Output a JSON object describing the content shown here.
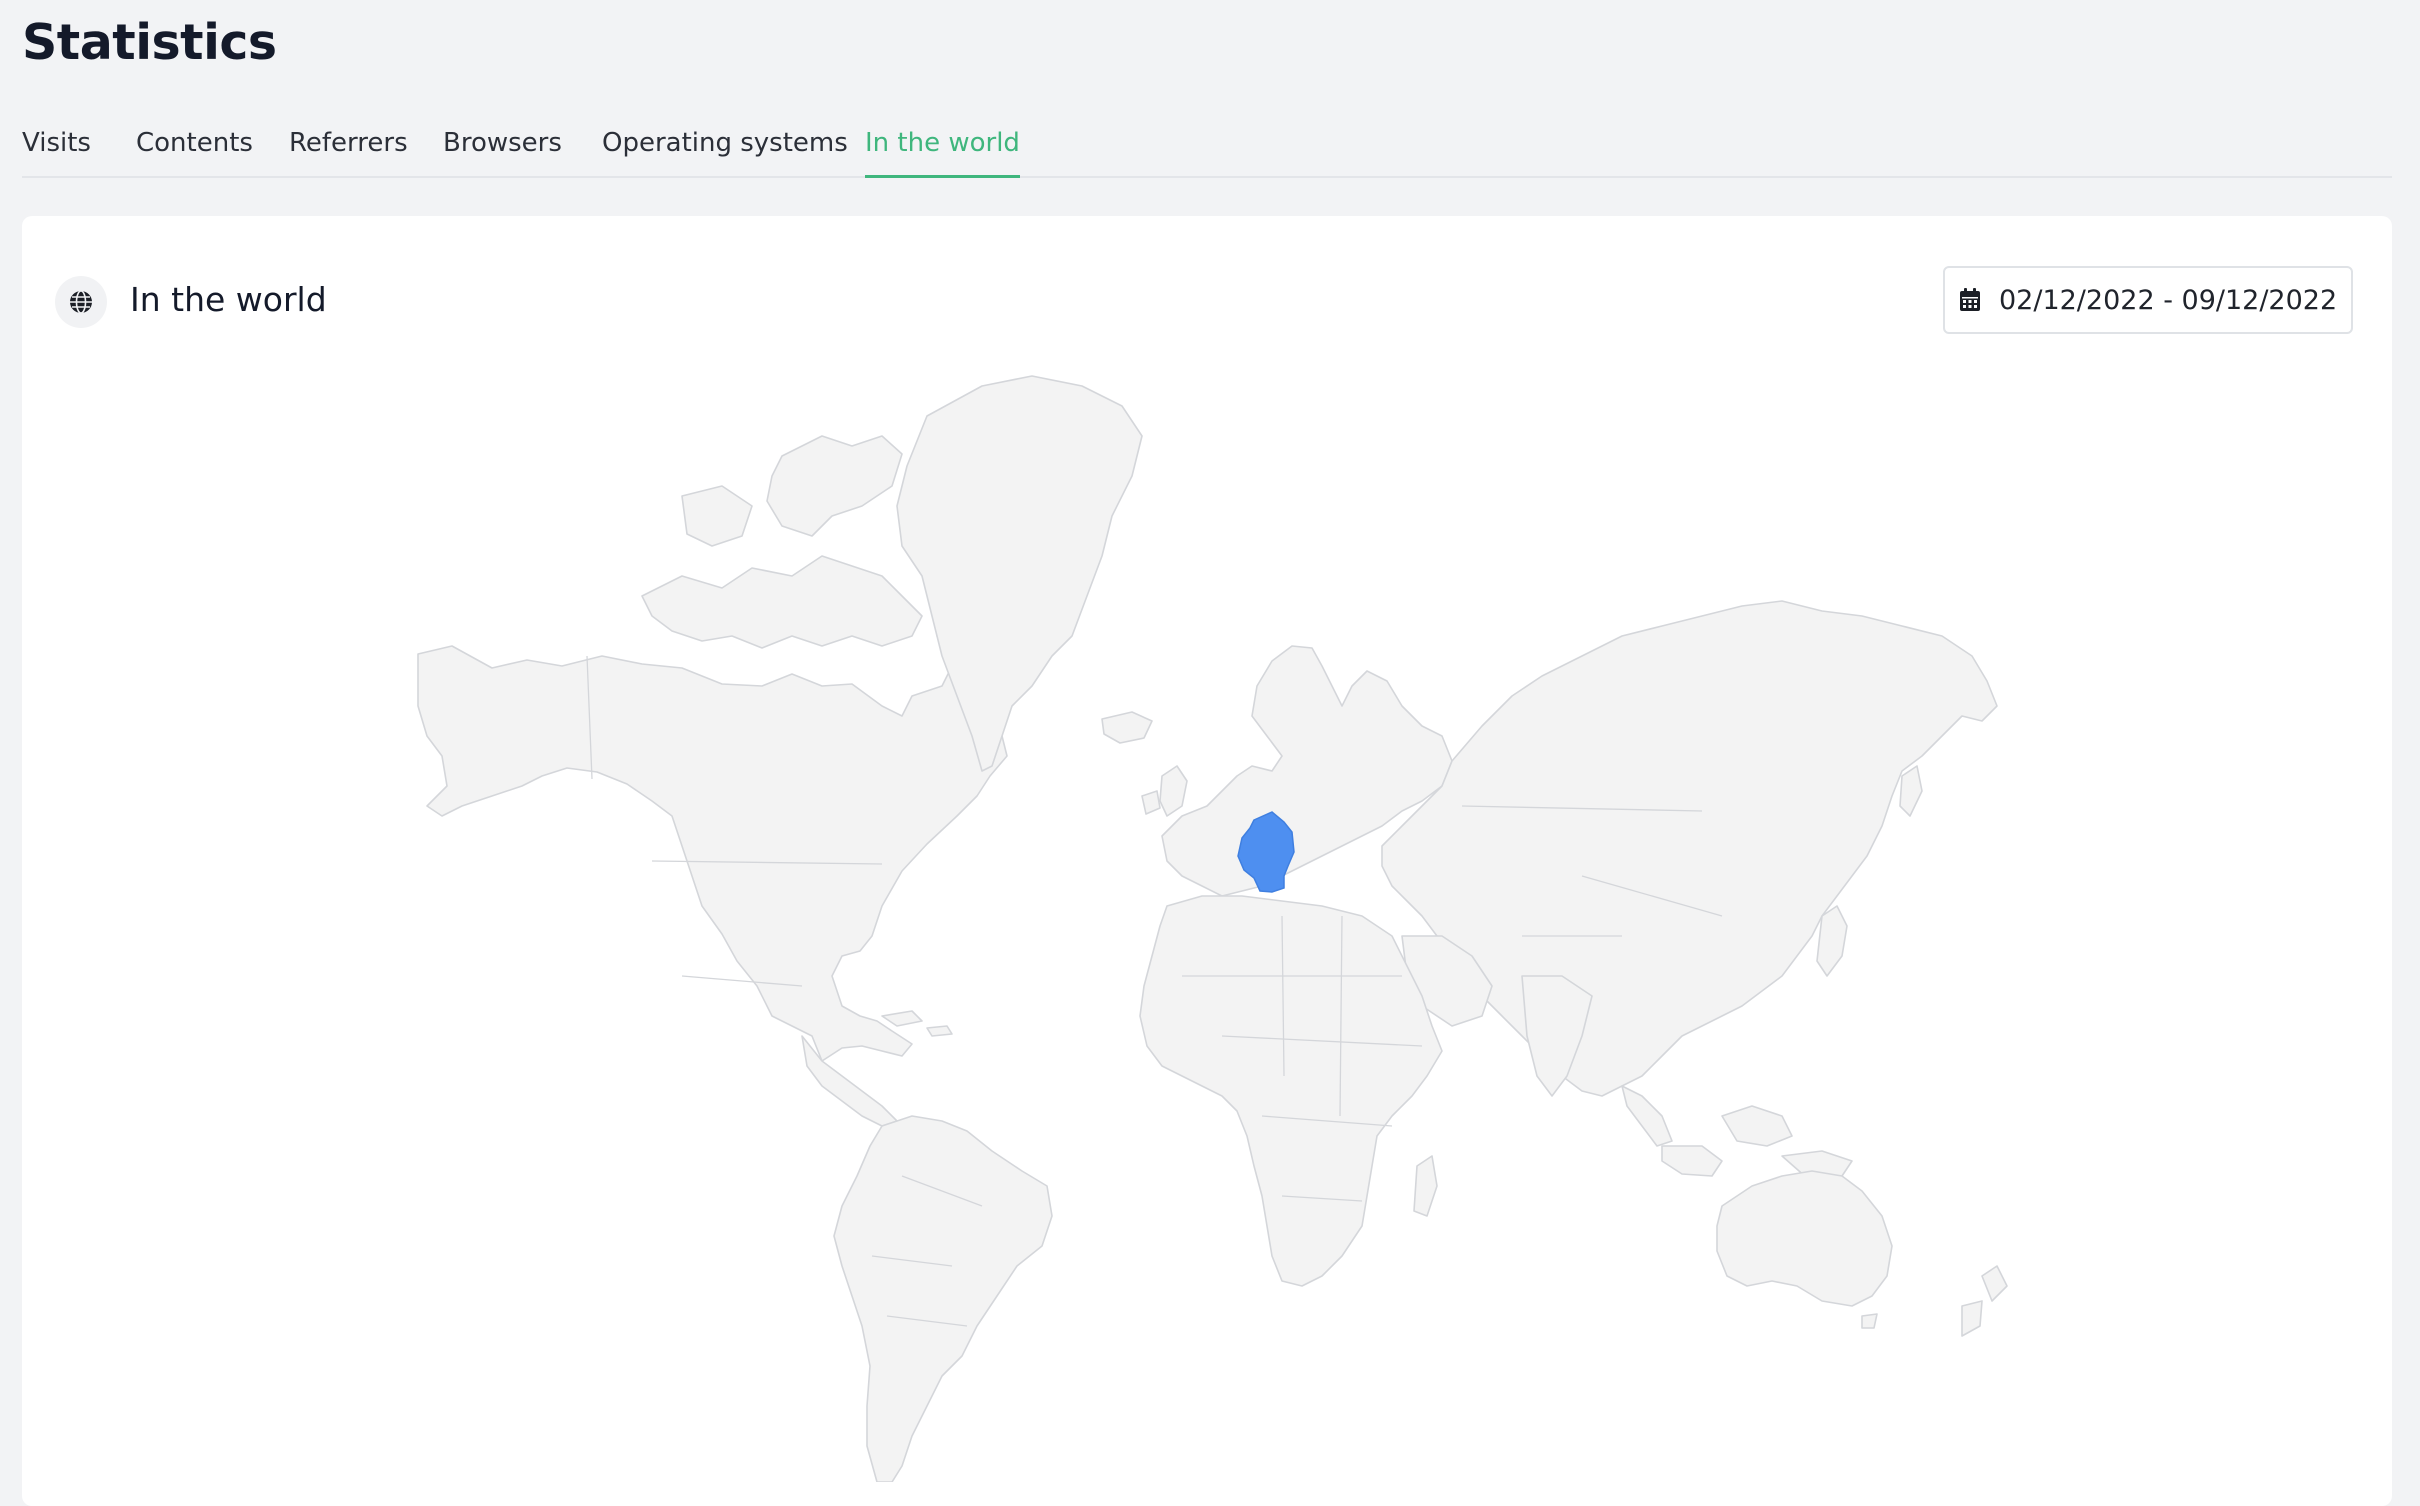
{
  "page": {
    "title": "Statistics"
  },
  "tabs": [
    {
      "label": "Visits",
      "active": false
    },
    {
      "label": "Contents",
      "active": false
    },
    {
      "label": "Referrers",
      "active": false
    },
    {
      "label": "Browsers",
      "active": false
    },
    {
      "label": "Operating systems",
      "active": false
    },
    {
      "label": "In the world",
      "active": true
    }
  ],
  "card": {
    "title": "In the world",
    "icon": "globe-icon",
    "date_range": {
      "icon": "calendar-icon",
      "value": "02/12/2022 - 09/12/2022"
    }
  },
  "map": {
    "highlighted_countries": [
      "Germany"
    ],
    "land_color": "#f3f3f3",
    "border_color": "#d4d6da",
    "highlight_color": "#4e8ff0"
  },
  "colors": {
    "accent": "#3fb67d",
    "background": "#f2f3f5",
    "card": "#ffffff"
  }
}
